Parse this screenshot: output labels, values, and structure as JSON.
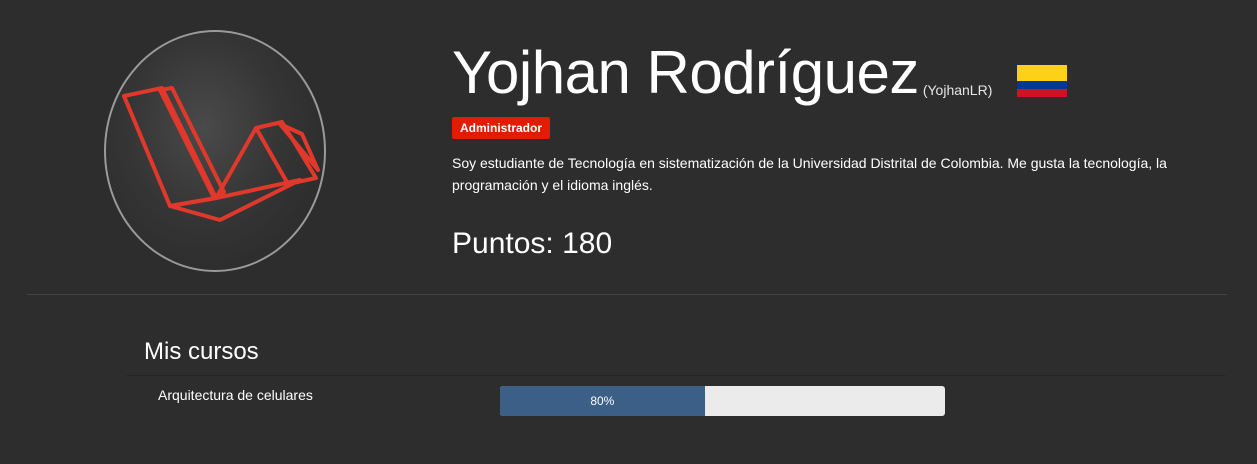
{
  "profile": {
    "full_name": "Yojhan Rodríguez",
    "username": "(YojhanLR)",
    "avatar_icon": "laravel-logo-icon",
    "country_flag_icon": "colombia-flag-icon",
    "flag_colors": {
      "yellow": "#fcd116",
      "blue": "#003893",
      "red": "#ce1126"
    },
    "role": "Administrador",
    "role_color": "#e11d00",
    "bio": "Soy estudiante de Tecnología en sistematización de la Universidad Distrital de Colombia. Me gusta la tecnología, la programación y el idioma inglés.",
    "points_label": "Puntos: 180"
  },
  "courses": {
    "title": "Mis cursos",
    "items": [
      {
        "name": "Arquitectura de celulares",
        "progress": 0.8,
        "progress_label": "80%",
        "progress_color": "#3b5f86"
      }
    ]
  },
  "theme": {
    "background": "#2d2d2d",
    "logo_color": "#e0392b"
  }
}
